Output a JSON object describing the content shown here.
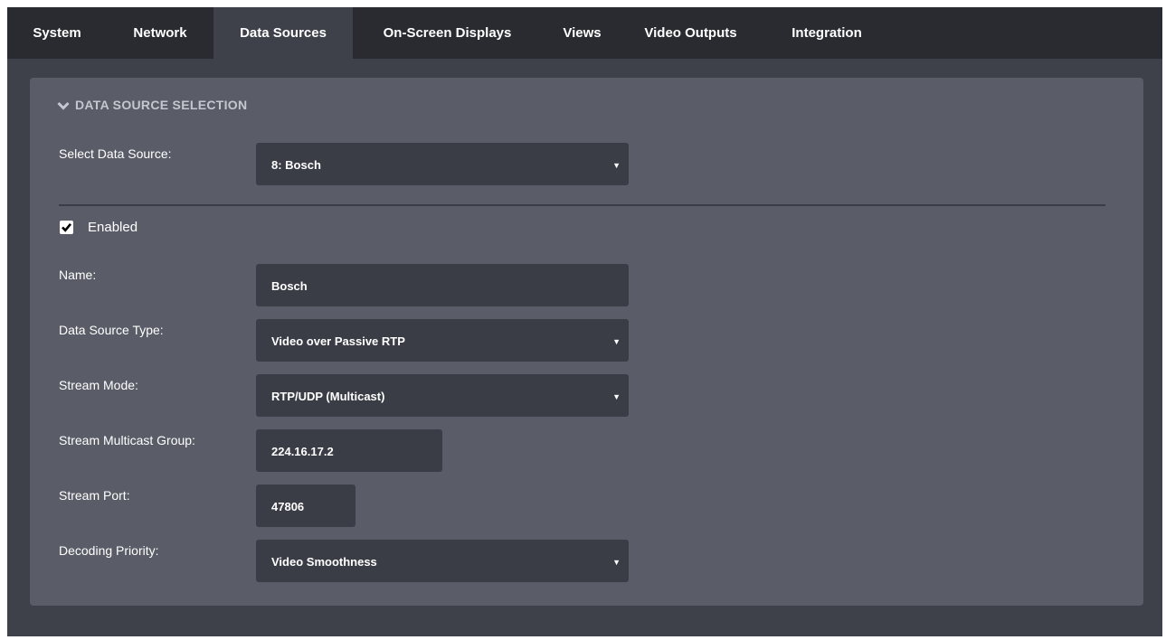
{
  "tabs": [
    {
      "label": "System",
      "active": false
    },
    {
      "label": "Network",
      "active": false
    },
    {
      "label": "Data Sources",
      "active": true
    },
    {
      "label": "On-Screen Displays",
      "active": false
    },
    {
      "label": "Views",
      "active": false
    },
    {
      "label": "Video Outputs",
      "active": false
    },
    {
      "label": "Integration",
      "active": false
    }
  ],
  "section": {
    "title": "DATA SOURCE SELECTION",
    "icon": "chevron-down-icon"
  },
  "select_source": {
    "label": "Select Data Source:",
    "value": "8: Bosch"
  },
  "enabled": {
    "label": "Enabled",
    "checked": true
  },
  "form": {
    "name": {
      "label": "Name:",
      "value": "Bosch"
    },
    "type": {
      "label": "Data Source Type:",
      "value": "Video over Passive RTP"
    },
    "stream_mode": {
      "label": "Stream Mode:",
      "value": "RTP/UDP (Multicast)"
    },
    "multicast_group": {
      "label": "Stream Multicast Group:",
      "value": "224.16.17.2"
    },
    "port": {
      "label": "Stream Port:",
      "value": "47806"
    },
    "priority": {
      "label": "Decoding Priority:",
      "value": "Video Smoothness"
    }
  },
  "colors": {
    "tabbar_bg": "#2a2b31",
    "window_bg": "#3f414a",
    "panel_bg": "#5a5d68",
    "field_bg": "#3b3d46",
    "text": "#ffffff",
    "section_header": "#c5c7ce"
  }
}
